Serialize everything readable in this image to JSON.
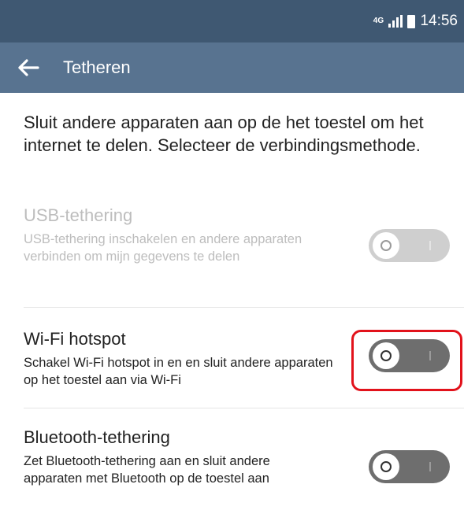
{
  "status_bar": {
    "network_badge": "4G",
    "signal_icon": "signal-icon",
    "battery_icon": "battery-icon",
    "time": "14:56"
  },
  "app_bar": {
    "back_icon": "arrow-left-icon",
    "title": "Tetheren",
    "color": "#587390"
  },
  "intro_text": "Sluit andere apparaten aan op de het toestel om het internet te delen. Selecteer de verbindingsmethode.",
  "settings": [
    {
      "title": "USB-tethering",
      "description": "USB-tethering inschakelen en andere apparaten verbinden om mijn gegevens te delen",
      "enabled": false,
      "toggle_on": false
    },
    {
      "title": "Wi-Fi hotspot",
      "description": "Schakel Wi-Fi hotspot in en en sluit andere apparaten op het toestel aan via Wi-Fi",
      "enabled": true,
      "toggle_on": false,
      "highlighted": true
    },
    {
      "title": "Bluetooth-tethering",
      "description": "Zet Bluetooth-tethering aan en sluit andere apparaten met Bluetooth op de toestel aan",
      "enabled": true,
      "toggle_on": false
    }
  ],
  "colors": {
    "status_bar": "#3f5872",
    "highlight": "#e2121b"
  }
}
